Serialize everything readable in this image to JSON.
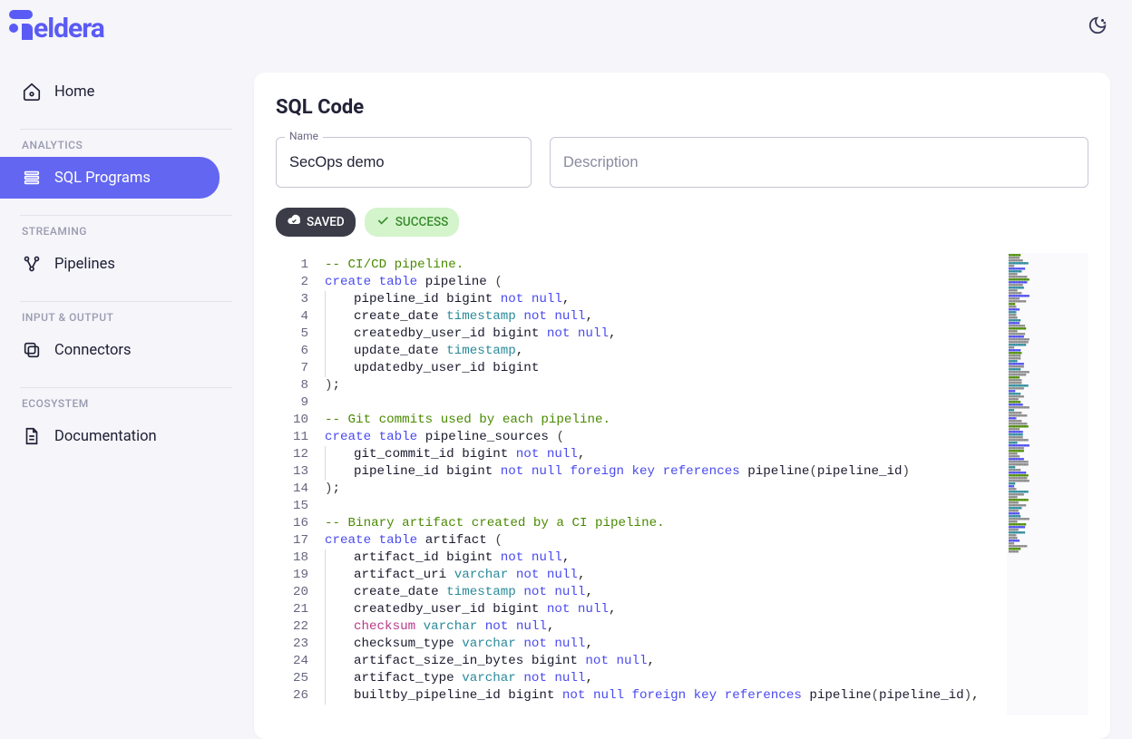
{
  "brand": "eldera",
  "header": {
    "title": "SQL Code"
  },
  "sidebar": {
    "items": [
      {
        "label": "Home",
        "icon": "home-icon",
        "section": null
      },
      {
        "label": "SQL Programs",
        "icon": "sql-programs-icon",
        "section": "ANALYTICS",
        "active": true
      },
      {
        "label": "Pipelines",
        "icon": "pipelines-icon",
        "section": "STREAMING"
      },
      {
        "label": "Connectors",
        "icon": "connectors-icon",
        "section": "INPUT & OUTPUT"
      },
      {
        "label": "Documentation",
        "icon": "documentation-icon",
        "section": "ECOSYSTEM"
      }
    ],
    "sections": {
      "analytics": "ANALYTICS",
      "streaming": "STREAMING",
      "input_output": "INPUT & OUTPUT",
      "ecosystem": "ECOSYSTEM"
    }
  },
  "form": {
    "name_label": "Name",
    "name_value": "SecOps demo",
    "description_placeholder": "Description",
    "description_value": ""
  },
  "status": {
    "saved_label": "SAVED",
    "success_label": "SUCCESS"
  },
  "editor": {
    "lines": [
      {
        "n": 1,
        "tokens": [
          {
            "t": "-- CI/CD pipeline.",
            "c": "comment"
          }
        ],
        "hl": true
      },
      {
        "n": 2,
        "tokens": [
          {
            "t": "create",
            "c": "keyword"
          },
          {
            "t": " "
          },
          {
            "t": "table",
            "c": "keyword"
          },
          {
            "t": " pipeline "
          },
          {
            "t": "(",
            "c": "paren"
          }
        ]
      },
      {
        "n": 3,
        "indent": 1,
        "tokens": [
          {
            "t": "pipeline_id bigint "
          },
          {
            "t": "not",
            "c": "not"
          },
          {
            "t": " "
          },
          {
            "t": "null",
            "c": "null"
          },
          {
            "t": ",",
            "c": "punc"
          }
        ]
      },
      {
        "n": 4,
        "indent": 1,
        "tokens": [
          {
            "t": "create_date "
          },
          {
            "t": "timestamp",
            "c": "type"
          },
          {
            "t": " "
          },
          {
            "t": "not",
            "c": "not"
          },
          {
            "t": " "
          },
          {
            "t": "null",
            "c": "null"
          },
          {
            "t": ",",
            "c": "punc"
          }
        ]
      },
      {
        "n": 5,
        "indent": 1,
        "tokens": [
          {
            "t": "createdby_user_id bigint "
          },
          {
            "t": "not",
            "c": "not"
          },
          {
            "t": " "
          },
          {
            "t": "null",
            "c": "null"
          },
          {
            "t": ",",
            "c": "punc"
          }
        ]
      },
      {
        "n": 6,
        "indent": 1,
        "tokens": [
          {
            "t": "update_date "
          },
          {
            "t": "timestamp",
            "c": "type"
          },
          {
            "t": ",",
            "c": "punc"
          }
        ]
      },
      {
        "n": 7,
        "indent": 1,
        "tokens": [
          {
            "t": "updatedby_user_id bigint"
          }
        ]
      },
      {
        "n": 8,
        "tokens": [
          {
            "t": ")",
            "c": "paren"
          },
          {
            "t": ";",
            "c": "punc"
          }
        ]
      },
      {
        "n": 9,
        "tokens": []
      },
      {
        "n": 10,
        "tokens": [
          {
            "t": "-- Git commits used by each pipeline.",
            "c": "comment"
          }
        ]
      },
      {
        "n": 11,
        "tokens": [
          {
            "t": "create",
            "c": "keyword"
          },
          {
            "t": " "
          },
          {
            "t": "table",
            "c": "keyword"
          },
          {
            "t": " pipeline_sources "
          },
          {
            "t": "(",
            "c": "paren"
          }
        ]
      },
      {
        "n": 12,
        "indent": 1,
        "tokens": [
          {
            "t": "git_commit_id bigint "
          },
          {
            "t": "not",
            "c": "not"
          },
          {
            "t": " "
          },
          {
            "t": "null",
            "c": "null"
          },
          {
            "t": ",",
            "c": "punc"
          }
        ]
      },
      {
        "n": 13,
        "indent": 1,
        "tokens": [
          {
            "t": "pipeline_id bigint "
          },
          {
            "t": "not",
            "c": "not"
          },
          {
            "t": " "
          },
          {
            "t": "null",
            "c": "null"
          },
          {
            "t": " "
          },
          {
            "t": "foreign",
            "c": "keyword"
          },
          {
            "t": " "
          },
          {
            "t": "key",
            "c": "keyword"
          },
          {
            "t": " "
          },
          {
            "t": "references",
            "c": "keyword"
          },
          {
            "t": " pipeline"
          },
          {
            "t": "(",
            "c": "paren"
          },
          {
            "t": "pipeline_id"
          },
          {
            "t": ")",
            "c": "paren"
          }
        ]
      },
      {
        "n": 14,
        "tokens": [
          {
            "t": ")",
            "c": "paren"
          },
          {
            "t": ";",
            "c": "punc"
          }
        ]
      },
      {
        "n": 15,
        "tokens": []
      },
      {
        "n": 16,
        "tokens": [
          {
            "t": "-- Binary artifact created by a CI pipeline.",
            "c": "comment"
          }
        ]
      },
      {
        "n": 17,
        "tokens": [
          {
            "t": "create",
            "c": "keyword"
          },
          {
            "t": " "
          },
          {
            "t": "table",
            "c": "keyword"
          },
          {
            "t": " artifact "
          },
          {
            "t": "(",
            "c": "paren"
          }
        ]
      },
      {
        "n": 18,
        "indent": 1,
        "tokens": [
          {
            "t": "artifact_id bigint "
          },
          {
            "t": "not",
            "c": "not"
          },
          {
            "t": " "
          },
          {
            "t": "null",
            "c": "null"
          },
          {
            "t": ",",
            "c": "punc"
          }
        ]
      },
      {
        "n": 19,
        "indent": 1,
        "tokens": [
          {
            "t": "artifact_uri "
          },
          {
            "t": "varchar",
            "c": "type"
          },
          {
            "t": " "
          },
          {
            "t": "not",
            "c": "not"
          },
          {
            "t": " "
          },
          {
            "t": "null",
            "c": "null"
          },
          {
            "t": ",",
            "c": "punc"
          }
        ]
      },
      {
        "n": 20,
        "indent": 1,
        "tokens": [
          {
            "t": "create_date "
          },
          {
            "t": "timestamp",
            "c": "type"
          },
          {
            "t": " "
          },
          {
            "t": "not",
            "c": "not"
          },
          {
            "t": " "
          },
          {
            "t": "null",
            "c": "null"
          },
          {
            "t": ",",
            "c": "punc"
          }
        ]
      },
      {
        "n": 21,
        "indent": 1,
        "tokens": [
          {
            "t": "createdby_user_id bigint "
          },
          {
            "t": "not",
            "c": "not"
          },
          {
            "t": " "
          },
          {
            "t": "null",
            "c": "null"
          },
          {
            "t": ",",
            "c": "punc"
          }
        ]
      },
      {
        "n": 22,
        "indent": 1,
        "tokens": [
          {
            "t": "checksum",
            "c": "fn"
          },
          {
            "t": " "
          },
          {
            "t": "varchar",
            "c": "type"
          },
          {
            "t": " "
          },
          {
            "t": "not",
            "c": "not"
          },
          {
            "t": " "
          },
          {
            "t": "null",
            "c": "null"
          },
          {
            "t": ",",
            "c": "punc"
          }
        ]
      },
      {
        "n": 23,
        "indent": 1,
        "tokens": [
          {
            "t": "checksum_type "
          },
          {
            "t": "varchar",
            "c": "type"
          },
          {
            "t": " "
          },
          {
            "t": "not",
            "c": "not"
          },
          {
            "t": " "
          },
          {
            "t": "null",
            "c": "null"
          },
          {
            "t": ",",
            "c": "punc"
          }
        ]
      },
      {
        "n": 24,
        "indent": 1,
        "tokens": [
          {
            "t": "artifact_size_in_bytes bigint "
          },
          {
            "t": "not",
            "c": "not"
          },
          {
            "t": " "
          },
          {
            "t": "null",
            "c": "null"
          },
          {
            "t": ",",
            "c": "punc"
          }
        ]
      },
      {
        "n": 25,
        "indent": 1,
        "tokens": [
          {
            "t": "artifact_type "
          },
          {
            "t": "varchar",
            "c": "type"
          },
          {
            "t": " "
          },
          {
            "t": "not",
            "c": "not"
          },
          {
            "t": " "
          },
          {
            "t": "null",
            "c": "null"
          },
          {
            "t": ",",
            "c": "punc"
          }
        ]
      },
      {
        "n": 26,
        "indent": 1,
        "tokens": [
          {
            "t": "builtby_pipeline_id bigint "
          },
          {
            "t": "not",
            "c": "not"
          },
          {
            "t": " "
          },
          {
            "t": "null",
            "c": "null"
          },
          {
            "t": " "
          },
          {
            "t": "foreign",
            "c": "keyword"
          },
          {
            "t": " "
          },
          {
            "t": "key",
            "c": "keyword"
          },
          {
            "t": " "
          },
          {
            "t": "references",
            "c": "keyword"
          },
          {
            "t": " pipeline"
          },
          {
            "t": "(",
            "c": "paren"
          },
          {
            "t": "pipeline_id"
          },
          {
            "t": ")",
            "c": "paren"
          },
          {
            "t": ",",
            "c": "punc"
          }
        ]
      }
    ]
  }
}
